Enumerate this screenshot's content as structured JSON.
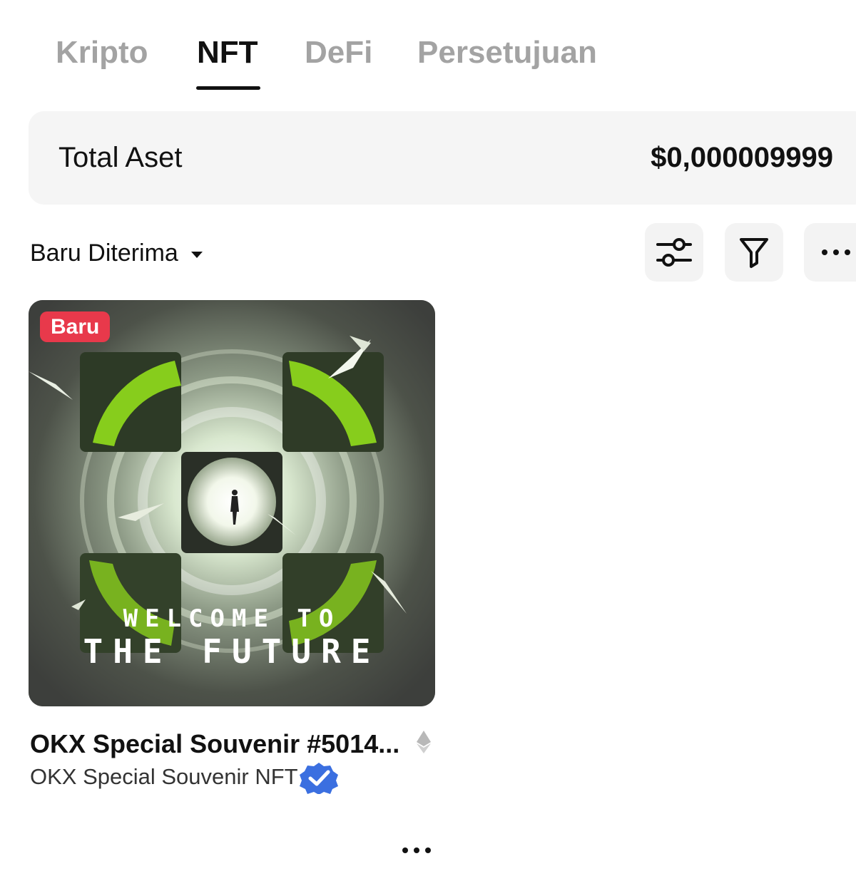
{
  "tabs": [
    {
      "label": "Kripto",
      "active": false
    },
    {
      "label": "NFT",
      "active": true
    },
    {
      "label": "DeFi",
      "active": false
    },
    {
      "label": "Persetujuan",
      "active": false
    }
  ],
  "summary": {
    "label": "Total Aset",
    "value": "$0,000009999"
  },
  "toolbar": {
    "sort_label": "Baru Diterima",
    "icons": [
      "sliders-icon",
      "filter-icon",
      "more-icon"
    ]
  },
  "nft": {
    "badge": "Baru",
    "artwork_line1": "WELCOME TO",
    "artwork_line2": "THE FUTURE",
    "title": "OKX Special Souvenir #5014...",
    "collection": "OKX Special Souvenir NFT",
    "chain_icon": "ethereum-icon",
    "verified_icon": "verified-badge-icon"
  },
  "colors": {
    "badge": "#e8394b",
    "verified": "#3b6fe0",
    "accent_green": "#a6ff1a"
  }
}
